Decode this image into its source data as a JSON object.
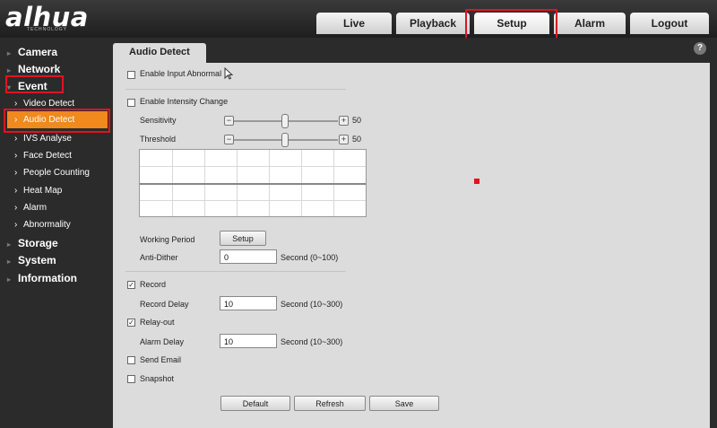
{
  "logo": {
    "text": "alhua",
    "sub": "TECHNOLOGY"
  },
  "top_tabs": [
    {
      "label": "Live"
    },
    {
      "label": "Playback"
    },
    {
      "label": "Setup"
    },
    {
      "label": "Alarm"
    },
    {
      "label": "Logout"
    }
  ],
  "sidebar": {
    "camera": "Camera",
    "network": "Network",
    "event": "Event",
    "items": [
      "Video Detect",
      "Audio Detect",
      "IVS Analyse",
      "Face Detect",
      "People Counting",
      "Heat Map",
      "Alarm",
      "Abnormality"
    ],
    "storage": "Storage",
    "system": "System",
    "information": "Information"
  },
  "page": {
    "tab_title": "Audio Detect",
    "help": "?"
  },
  "form": {
    "enable_input_abnormal": {
      "label": "Enable Input Abnormal",
      "checked": false
    },
    "enable_intensity_change": {
      "label": "Enable Intensity Change",
      "checked": false
    },
    "sensitivity": {
      "label": "Sensitivity",
      "value": "50",
      "level": 50
    },
    "threshold": {
      "label": "Threshold",
      "value": "50",
      "level": 50
    },
    "working_period": {
      "label": "Working Period",
      "button": "Setup"
    },
    "anti_dither": {
      "label": "Anti-Dither",
      "value": "0",
      "unit": "Second (0~100)"
    },
    "record": {
      "label": "Record",
      "checked": true
    },
    "record_delay": {
      "label": "Record Delay",
      "value": "10",
      "unit": "Second (10~300)"
    },
    "relay_out": {
      "label": "Relay-out",
      "checked": true
    },
    "alarm_delay": {
      "label": "Alarm Delay",
      "value": "10",
      "unit": "Second (10~300)"
    },
    "send_email": {
      "label": "Send Email",
      "checked": false
    },
    "snapshot": {
      "label": "Snapshot",
      "checked": false
    }
  },
  "buttons": {
    "default": "Default",
    "refresh": "Refresh",
    "save": "Save"
  },
  "glyphs": {
    "check": "✓",
    "minus": "−",
    "plus": "+",
    "chevron": "›",
    "arrow_right": "▸",
    "arrow_down": "▾"
  },
  "colors": {
    "highlight": "#e0141e",
    "active_item": "#f0891e"
  }
}
